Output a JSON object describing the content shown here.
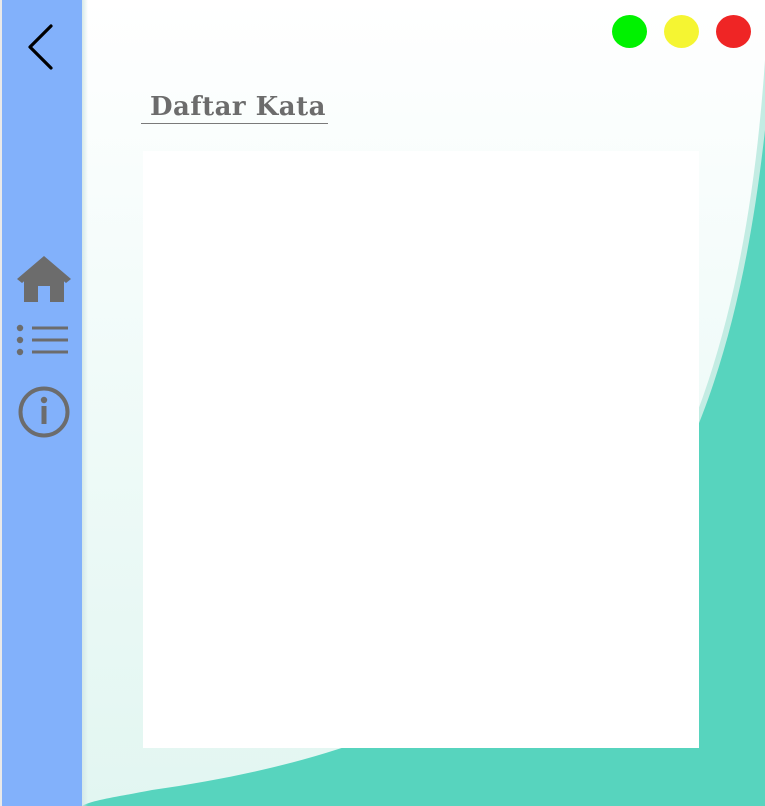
{
  "header": {
    "title": "Daftar Kata"
  },
  "sidebar": {
    "back_icon": "chevron-left-icon",
    "items": [
      {
        "name": "home",
        "icon": "home-icon"
      },
      {
        "name": "list",
        "icon": "list-icon"
      },
      {
        "name": "info",
        "icon": "info-icon"
      }
    ]
  },
  "window_controls": [
    {
      "name": "green",
      "color": "#00f200"
    },
    {
      "name": "yellow",
      "color": "#f5f532"
    },
    {
      "name": "red",
      "color": "#ef2525"
    }
  ],
  "word_list": {
    "items": []
  },
  "colors": {
    "sidebar": "#82b1fb",
    "accent_teal": "#57d4be",
    "icon_gray": "#6c6c6c",
    "title_gray": "#6c6c6c"
  }
}
